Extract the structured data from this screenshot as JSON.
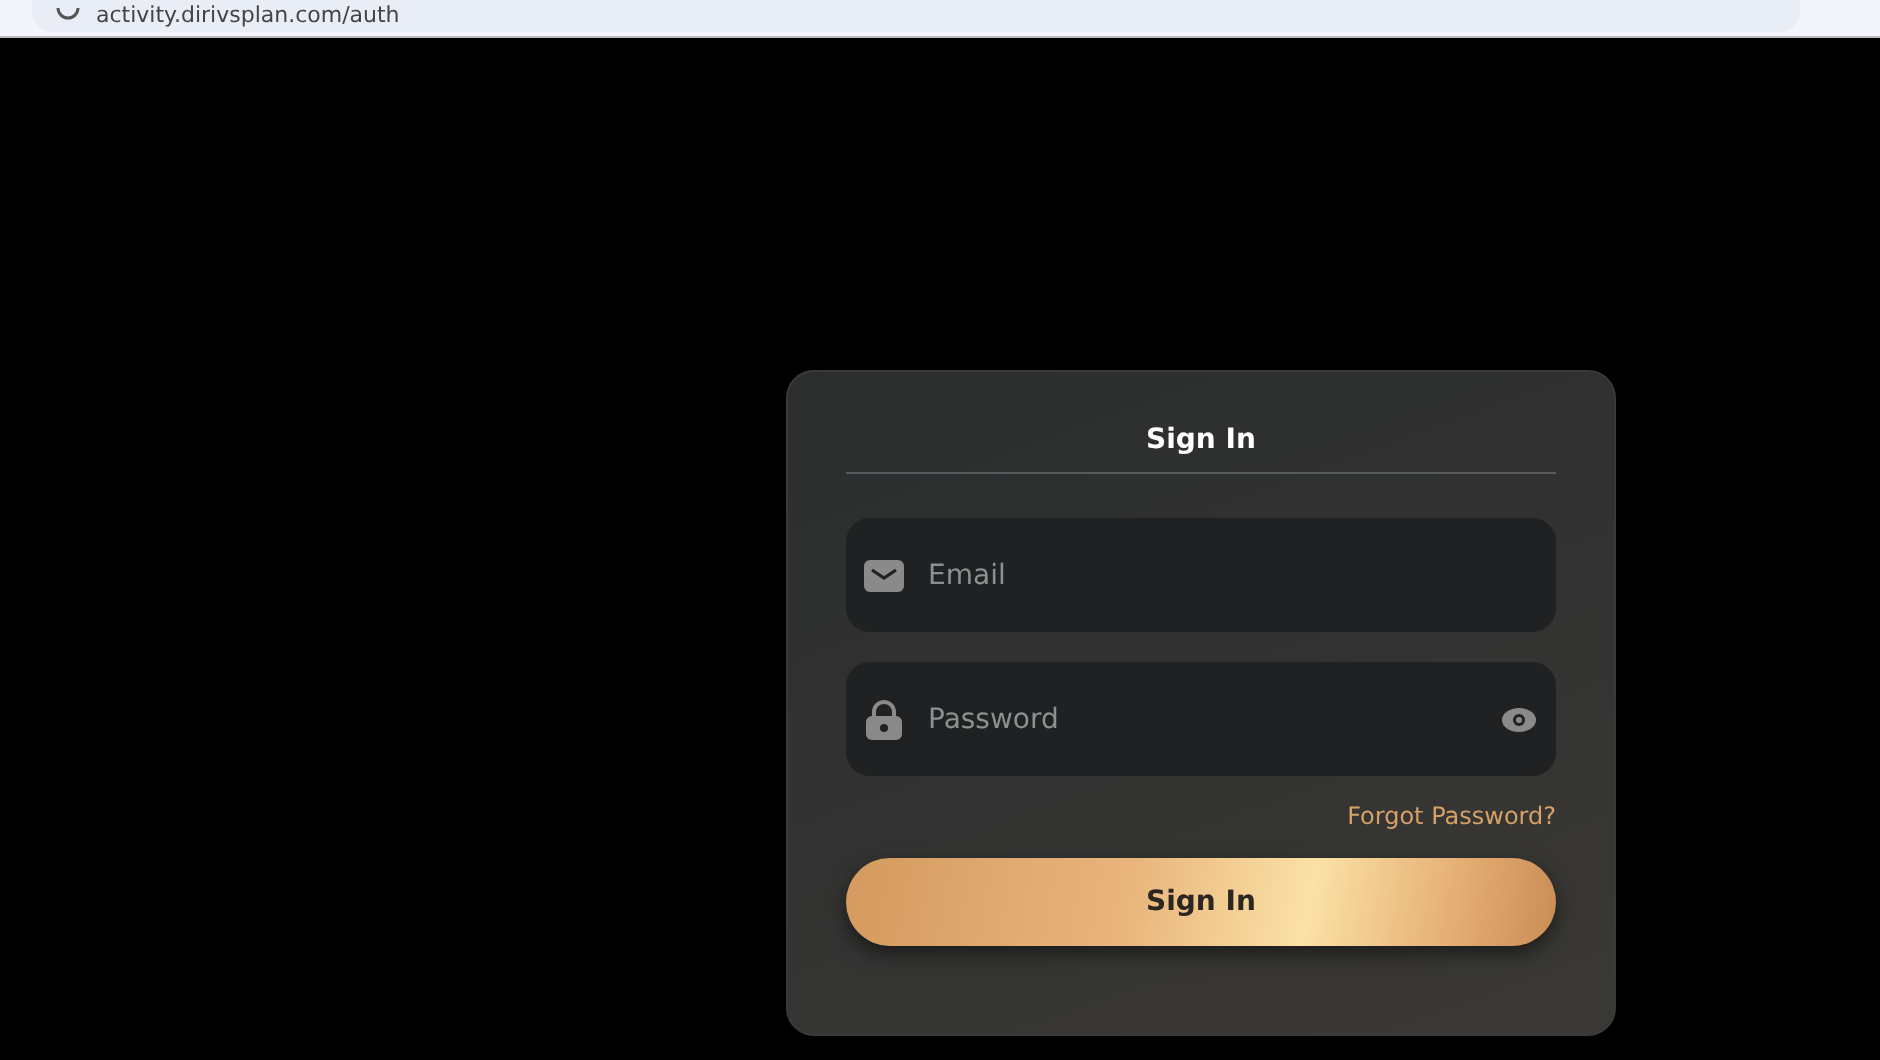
{
  "browser": {
    "address": "activity.dirivsplan.com/auth"
  },
  "login": {
    "title": "Sign In",
    "fields": [
      {
        "kind": "email",
        "placeholder": "Email"
      },
      {
        "kind": "password",
        "placeholder": "Password"
      }
    ],
    "forgot_link": "Forgot Password?",
    "submit": "Sign In"
  }
}
